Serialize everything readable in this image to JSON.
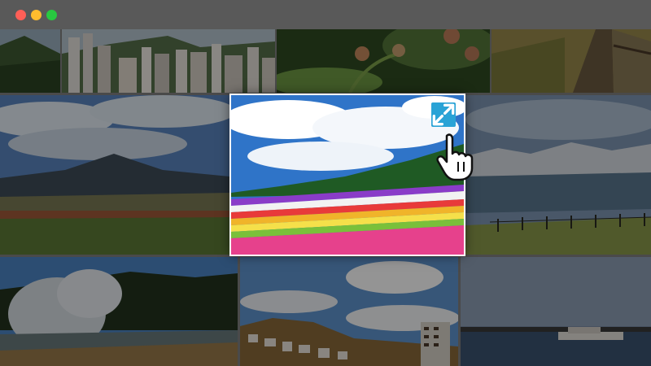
{
  "window": {
    "controls": [
      {
        "name": "close",
        "color": "#ff5f57"
      },
      {
        "name": "minimize",
        "color": "#febc2e"
      },
      {
        "name": "maximize",
        "color": "#28c840"
      }
    ]
  },
  "gallery": {
    "photos": [
      {
        "id": "hillside-forest",
        "state": "dimmed"
      },
      {
        "id": "city-skyline",
        "state": "dimmed"
      },
      {
        "id": "flower-buds",
        "state": "dimmed"
      },
      {
        "id": "wooden-boardwalk",
        "state": "dimmed"
      },
      {
        "id": "mountain-meadow",
        "state": "dimmed"
      },
      {
        "id": "flower-field-stripes",
        "state": "highlighted"
      },
      {
        "id": "snowy-range-fence",
        "state": "dimmed"
      },
      {
        "id": "geyser-steam",
        "state": "dimmed"
      },
      {
        "id": "coastal-town",
        "state": "dimmed"
      },
      {
        "id": "harbor-boat",
        "state": "dimmed"
      }
    ],
    "active_photo": "flower-field-stripes",
    "expand_icon": "expand-arrows-icon",
    "pointer_icon": "hand-pointer-icon"
  },
  "colors": {
    "titlebar": "#595959",
    "accent": "#2aa3d6",
    "dim_overlay": "rgba(0,0,0,0.42)"
  }
}
